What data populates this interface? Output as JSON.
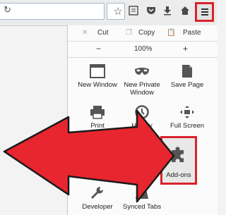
{
  "toolbar": {
    "reload_icon": "reload-icon",
    "icons": [
      "star-icon",
      "reading-list-icon",
      "pocket-icon",
      "download-icon",
      "home-icon",
      "hamburger-menu-icon"
    ]
  },
  "menu": {
    "edit": {
      "cut": "Cut",
      "copy": "Copy",
      "paste": "Paste"
    },
    "zoom": {
      "minus": "−",
      "level": "100%",
      "plus": "+"
    },
    "items": [
      {
        "label": "New Window",
        "icon": "new-window-icon"
      },
      {
        "label": "New Private Window",
        "icon": "private-mask-icon"
      },
      {
        "label": "Save Page",
        "icon": "save-page-icon"
      },
      {
        "label": "Print",
        "icon": "printer-icon"
      },
      {
        "label": "History",
        "icon": "history-clock-icon"
      },
      {
        "label": "Full Screen",
        "icon": "fullscreen-icon"
      },
      {
        "label": "Add-ons",
        "icon": "puzzle-icon"
      },
      {
        "label": "Developer",
        "icon": "wrench-icon"
      },
      {
        "label": "Synced Tabs",
        "icon": "synced-tabs-icon"
      }
    ]
  },
  "colors": {
    "highlight": "#d9232c",
    "arrow": "#e8262f"
  }
}
